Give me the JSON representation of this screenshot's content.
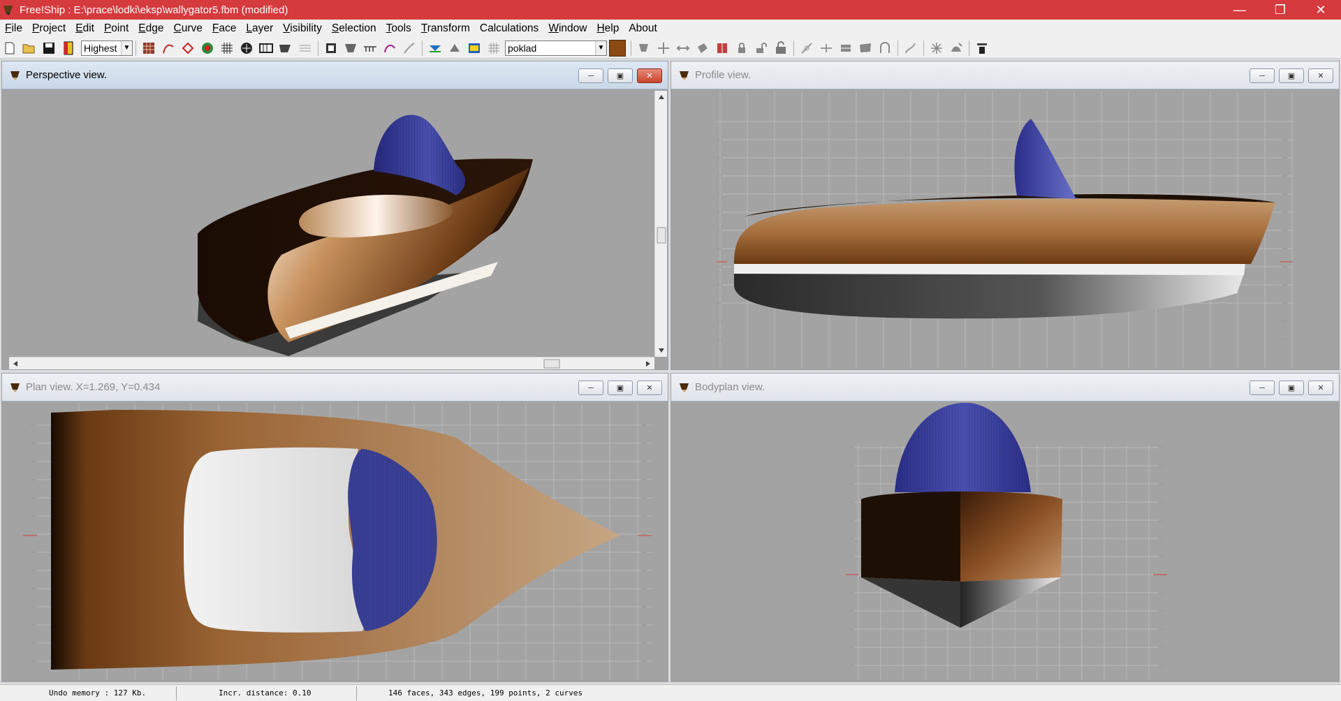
{
  "window": {
    "title": "Free!Ship : E:\\prace\\lodki\\eksp\\wallygator5.fbm (modified)"
  },
  "menu": [
    {
      "label": "File",
      "key": "F",
      "rest": "ile"
    },
    {
      "label": "Project",
      "key": "P",
      "rest": "roject"
    },
    {
      "label": "Edit",
      "key": "E",
      "rest": "dit"
    },
    {
      "label": "Point",
      "key": "P",
      "rest": "oint"
    },
    {
      "label": "Edge",
      "key": "E",
      "rest": "dge"
    },
    {
      "label": "Curve",
      "key": "C",
      "rest": "urve"
    },
    {
      "label": "Face",
      "key": "F",
      "rest": "ace"
    },
    {
      "label": "Layer",
      "key": "L",
      "rest": "ayer"
    },
    {
      "label": "Visibility",
      "key": "V",
      "rest": "isibility"
    },
    {
      "label": "Selection",
      "key": "S",
      "rest": "election"
    },
    {
      "label": "Tools",
      "key": "T",
      "rest": "ools"
    },
    {
      "label": "Transform",
      "key": "T",
      "rest": "ransform"
    },
    {
      "label": "Calculations",
      "key": "",
      "rest": "Calculations"
    },
    {
      "label": "Window",
      "key": "W",
      "rest": "indow"
    },
    {
      "label": "Help",
      "key": "H",
      "rest": "elp"
    },
    {
      "label": "About",
      "key": "",
      "rest": "About"
    }
  ],
  "toolbar": {
    "precision_value": "Highest",
    "layer_value": "poklad",
    "layer_color": "#8b4a14"
  },
  "views": {
    "perspective": {
      "title": "Perspective view."
    },
    "profile": {
      "title": "Profile view."
    },
    "plan": {
      "title": "Plan view.  X=1.269,   Y=0.434"
    },
    "bodyplan": {
      "title": "Bodyplan view."
    }
  },
  "status": {
    "undo": "Undo memory : 127 Kb.",
    "incr": "Incr. distance: 0.10",
    "counts": "146 faces, 343 edges, 199 points, 2 curves"
  },
  "colors": {
    "titlebar": "#d53a3e",
    "hull_dark": "#1e0f04",
    "hull_light": "#c9a27c",
    "deck": "#f2f2f2",
    "cabin": "#3a3f96",
    "bottom": "#3a3a3a"
  }
}
